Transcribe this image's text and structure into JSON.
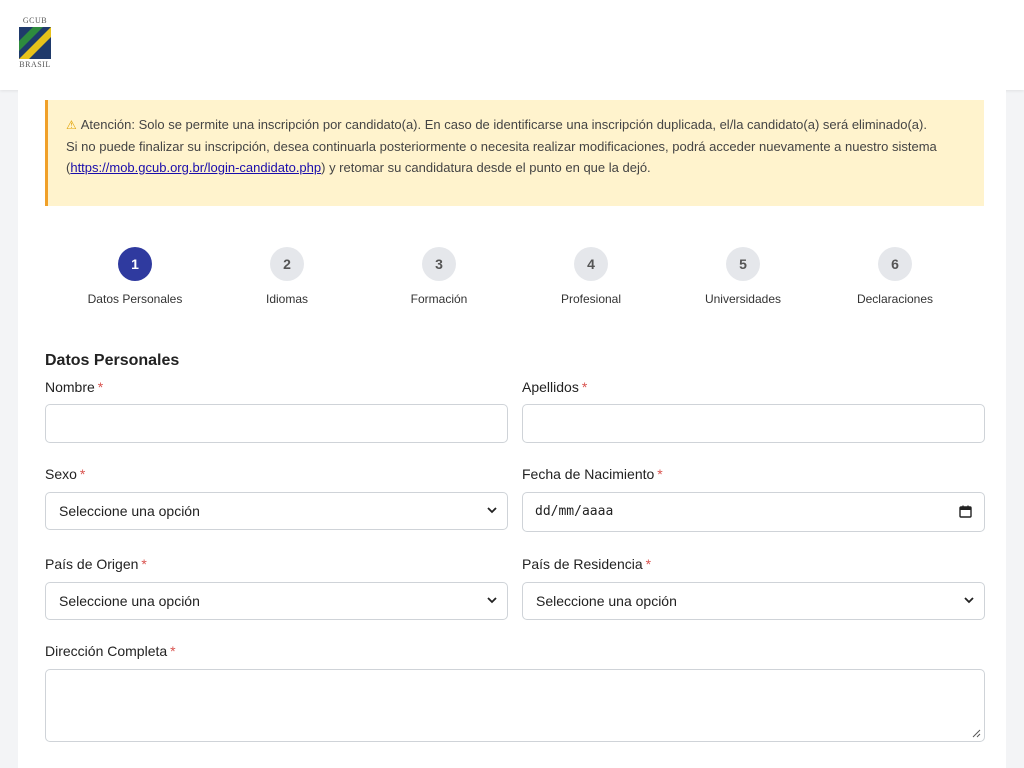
{
  "header": {
    "logo_top": "GCUB",
    "logo_bottom": "BRASIL"
  },
  "alert": {
    "line1": "Atención: Solo se permite una inscripción por candidato(a). En caso de identificarse una inscripción duplicada, el/la candidato(a) será eliminado(a).",
    "line2_prefix": "Si no puede finalizar su inscripción, desea continuarla posteriormente o necesita realizar modificaciones, podrá acceder nuevamente a nuestro sistema (",
    "link_text": "https://mob.gcub.org.br/login-candidato.php",
    "line2_suffix": ") y retomar su candidatura desde el punto en que la dejó.",
    "icon": "warning-icon"
  },
  "steps": [
    {
      "number": "1",
      "label": "Datos Personales",
      "active": true
    },
    {
      "number": "2",
      "label": "Idiomas",
      "active": false
    },
    {
      "number": "3",
      "label": "Formación",
      "active": false
    },
    {
      "number": "4",
      "label": "Profesional",
      "active": false
    },
    {
      "number": "5",
      "label": "Universidades",
      "active": false
    },
    {
      "number": "6",
      "label": "Declaraciones",
      "active": false
    }
  ],
  "form": {
    "section_title": "Datos Personales",
    "required_mark": "*",
    "nombre_label": "Nombre",
    "nombre_value": "",
    "apellidos_label": "Apellidos",
    "apellidos_value": "",
    "sexo_label": "Sexo",
    "sexo_value": "Seleccione una opción",
    "fecha_label": "Fecha de Nacimiento",
    "fecha_value": "dd/mm/aaaa",
    "pais_origen_label": "País de Origen",
    "pais_origen_value": "Seleccione una opción",
    "pais_residencia_label": "País de Residencia",
    "pais_residencia_value": "Seleccione una opción",
    "direccion_label": "Dirección Completa",
    "direccion_value": ""
  },
  "colors": {
    "accent": "#2f3a9f",
    "alert_bg": "#fff3cd",
    "alert_border": "#f0a028",
    "required": "#d9534f"
  }
}
